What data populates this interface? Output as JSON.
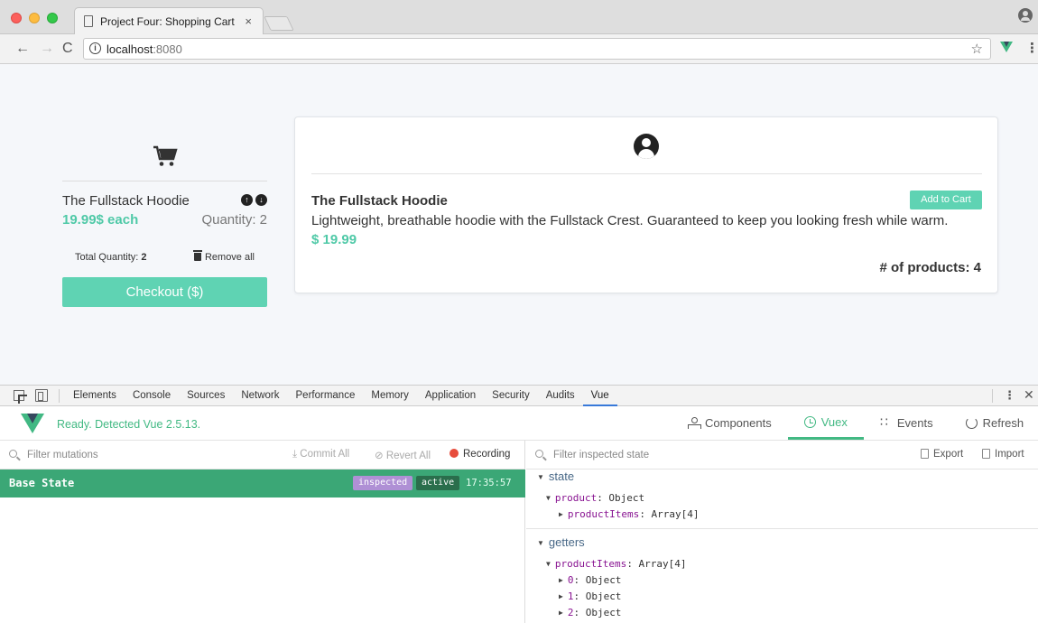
{
  "browser": {
    "tab_title": "Project Four: Shopping Cart",
    "tab_close": "×",
    "url_host": "localhost",
    "url_port": ":8080",
    "info_glyph": "i",
    "star_glyph": "☆",
    "menu_glyph": "⋮",
    "back_glyph": "←",
    "forward_glyph": "→",
    "reload_glyph": "C"
  },
  "cart": {
    "item_name": "The Fullstack Hoodie",
    "up_glyph": "↑",
    "down_glyph": "↓",
    "item_price": "19.99$ each",
    "item_quantity": "Quantity: 2",
    "total_quantity_label": "Total Quantity: ",
    "total_quantity_value": "2",
    "remove_all_label": "Remove all",
    "checkout_label": "Checkout ($)"
  },
  "product": {
    "name": "The Fullstack Hoodie",
    "add_to_cart_label": "Add to Cart",
    "description": "Lightweight, breathable hoodie with the Fullstack Crest. Guaranteed to keep you looking fresh while warm.",
    "price": "$ 19.99",
    "count_label": "# of products: 4"
  },
  "devtools": {
    "tabs": [
      "Elements",
      "Console",
      "Sources",
      "Network",
      "Performance",
      "Memory",
      "Application",
      "Security",
      "Audits",
      "Vue"
    ],
    "active_tab": "Vue",
    "kebab_glyph": "⋮",
    "close_glyph": "✕"
  },
  "vue_devtools": {
    "status": "Ready. Detected Vue 2.5.13.",
    "nav": {
      "components": "Components",
      "vuex": "Vuex",
      "events": "Events",
      "refresh": "Refresh"
    },
    "active_nav": "Vuex",
    "mutations": {
      "filter_placeholder": "Filter mutations",
      "commit_all": "⤓ Commit All",
      "revert_all": "⊘ Revert All",
      "recording": "Recording",
      "base_state": {
        "label": "Base State",
        "badge_inspected": "inspected",
        "badge_active": "active",
        "time": "17:35:57"
      }
    },
    "state_panel": {
      "filter_placeholder": "Filter inspected state",
      "export": "Export",
      "import": "Import",
      "state_heading": "state",
      "state_tree": [
        {
          "key": "product",
          "value": ": Object",
          "expanded": true
        },
        {
          "key": "productItems",
          "value": ": Array[4]",
          "expanded": false
        }
      ],
      "getters_heading": "getters",
      "getters_tree": [
        {
          "key": "productItems",
          "value": ": Array[4]",
          "expanded": true
        },
        {
          "key": "0",
          "value": ": Object",
          "expanded": false
        },
        {
          "key": "1",
          "value": ": Object",
          "expanded": false
        },
        {
          "key": "2",
          "value": ": Object",
          "expanded": false
        }
      ]
    }
  },
  "colors": {
    "accent_green": "#5fd3b3",
    "vue_green": "#42b983",
    "base_state_bg": "#3ba776",
    "badge_inspected": "#af90d5",
    "badge_active": "#2a6e4c",
    "record_red": "#e74c3c"
  }
}
